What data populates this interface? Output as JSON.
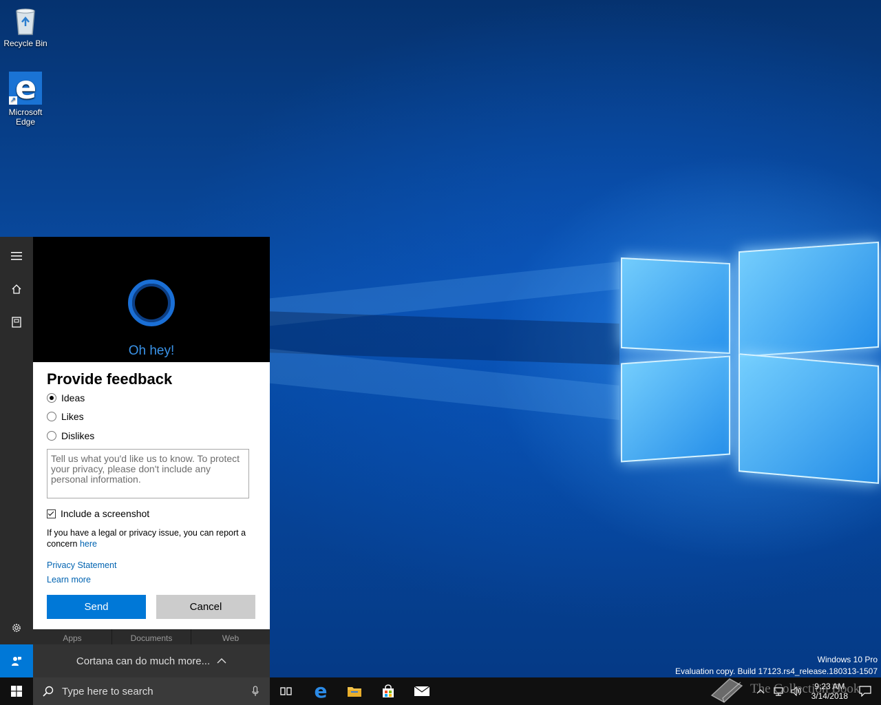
{
  "desktop": {
    "icons": [
      {
        "label": "Recycle Bin"
      },
      {
        "label": "Microsoft Edge"
      }
    ]
  },
  "cortana": {
    "greeting": "Oh hey!",
    "feedback": {
      "title": "Provide feedback",
      "options": [
        "Ideas",
        "Likes",
        "Dislikes"
      ],
      "selected": "Ideas",
      "textarea_placeholder": "Tell us what you'd like us to know. To protect your privacy, please don't include any personal information.",
      "screenshot_label": "Include a screenshot",
      "legal_text": "If you have a legal or privacy issue, you can report a concern",
      "legal_link": "here",
      "privacy_link": "Privacy Statement",
      "learn_more_link": "Learn more",
      "send_label": "Send",
      "cancel_label": "Cancel"
    },
    "filters": [
      "Apps",
      "Documents",
      "Web"
    ],
    "more_label": "Cortana can do much more..."
  },
  "taskbar": {
    "search_placeholder": "Type here to search",
    "time": "9:23 AM",
    "date": "3/14/2018"
  },
  "watermark": {
    "line1": "Windows 10 Pro",
    "line2": "Evaluation copy. Build 17123.rs4_release.180313-1507"
  },
  "overlay_brand": "The Collection Book",
  "colors": {
    "accent": "#0078d7",
    "cortana_blue": "#3a93e8",
    "link": "#0063b1"
  }
}
